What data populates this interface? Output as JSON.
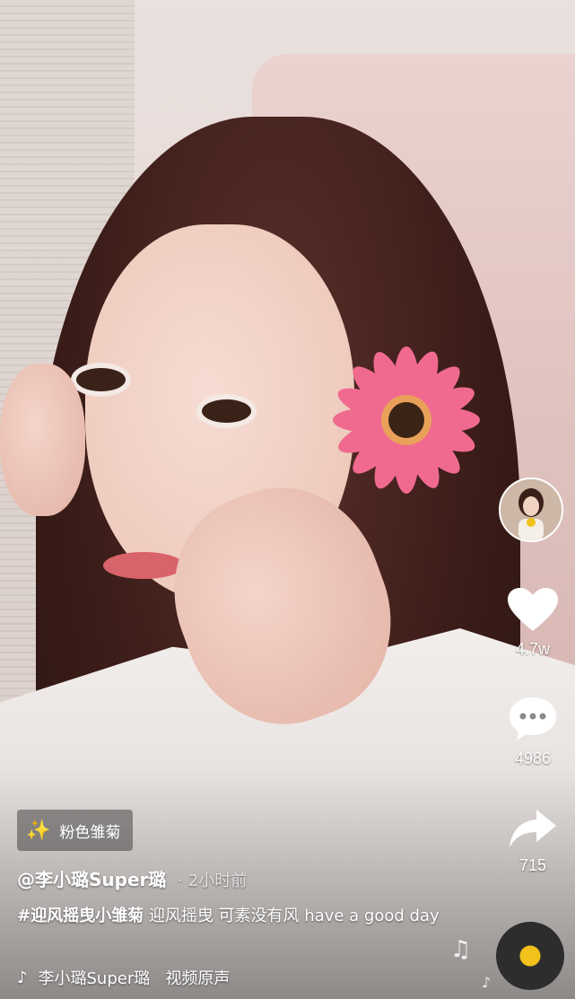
{
  "effect": {
    "label": "粉色雏菊",
    "icon": "sparkle-effect-icon"
  },
  "author": {
    "handle": "@李小璐Super璐",
    "time": "· 2小时前"
  },
  "caption": {
    "hashtag": "#迎风摇曳小雏菊",
    "text": "迎风摇曳 可素没有风 have a good day"
  },
  "music": {
    "title": "李小璐Super璐   视频原声",
    "icon": "music-note-icon"
  },
  "rail": {
    "likes": "4.7w",
    "comments": "4986",
    "shares": "715"
  },
  "colors": {
    "heart": "#ffffff",
    "disc_center": "#f2c21b",
    "flower_petal": "#f06a8f",
    "flower_center": "#3a2415"
  }
}
